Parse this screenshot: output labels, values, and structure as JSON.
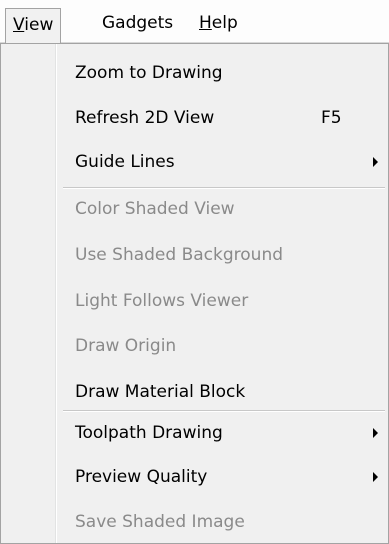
{
  "menubar": {
    "items": [
      {
        "label": "View",
        "mnemonic": "V",
        "rest": "iew"
      },
      {
        "label": "Gadgets"
      },
      {
        "label": "Help",
        "mnemonic": "H",
        "rest": "elp"
      }
    ]
  },
  "dropdown": {
    "group1": [
      {
        "label": "Zoom to Drawing",
        "enabled": true
      },
      {
        "label": "Refresh 2D View",
        "shortcut": "F5",
        "enabled": true
      },
      {
        "label": "Guide Lines",
        "submenu": true,
        "enabled": true
      }
    ],
    "group2": [
      {
        "label": "Color Shaded View",
        "enabled": false
      },
      {
        "label": "Use Shaded Background",
        "enabled": false
      },
      {
        "label": "Light Follows Viewer",
        "enabled": false
      },
      {
        "label": "Draw Origin",
        "enabled": false
      },
      {
        "label": "Draw Material Block",
        "enabled": true
      }
    ],
    "group3": [
      {
        "label": "Toolpath Drawing",
        "submenu": true,
        "enabled": true
      },
      {
        "label": "Preview Quality",
        "submenu": true,
        "enabled": true
      },
      {
        "label": "Save Shaded Image",
        "enabled": false
      }
    ]
  },
  "colors": {
    "disabled_text": "#8a8a8a",
    "menu_bg": "#f0f0f0",
    "border": "#a3a3a3"
  }
}
